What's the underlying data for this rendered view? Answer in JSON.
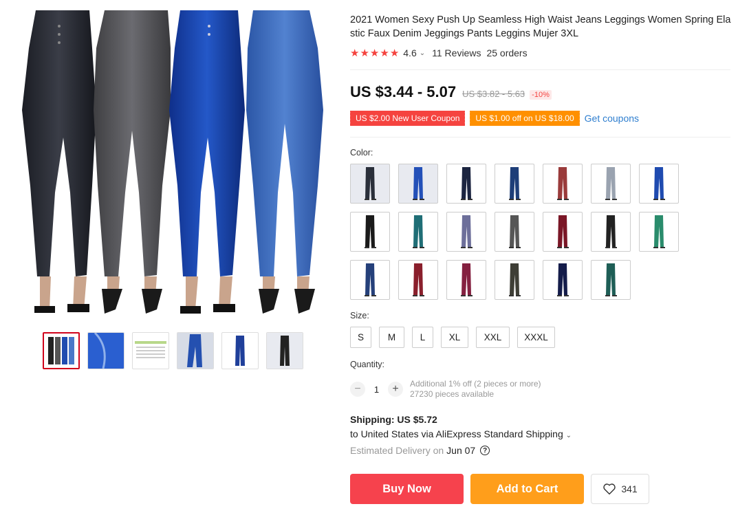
{
  "product": {
    "title": "2021 Women Sexy Push Up Seamless High Waist Jeans Leggings Women Spring Elastic Faux Denim Jeggings Pants Leggins Mujer 3XL",
    "rating": "4.6",
    "reviews": "11 Reviews",
    "orders": "25 orders"
  },
  "price": {
    "current": "US $3.44 - 5.07",
    "original": "US $3.82 - 5.63",
    "discount": "-10%"
  },
  "coupons": {
    "new_user": "US $2.00 New User Coupon",
    "store": "US $1.00 off on US $18.00",
    "get": "Get coupons"
  },
  "color": {
    "label": "Color:",
    "swatches": [
      {
        "name": "gray-stripe",
        "color": "#2a2f3a"
      },
      {
        "name": "blue",
        "color": "#2350b8"
      },
      {
        "name": "dark-navy",
        "color": "#1c2540"
      },
      {
        "name": "navy-denim",
        "color": "#1e3e78"
      },
      {
        "name": "red-brown",
        "color": "#9a3b3b"
      },
      {
        "name": "light-gray",
        "color": "#9aa3b0"
      },
      {
        "name": "royal-blue",
        "color": "#1f4bb0"
      },
      {
        "name": "black",
        "color": "#1a1a1a"
      },
      {
        "name": "teal-pattern",
        "color": "#1f6e76"
      },
      {
        "name": "purple-camo",
        "color": "#6d6f9a"
      },
      {
        "name": "gray-camo",
        "color": "#565656"
      },
      {
        "name": "burgundy",
        "color": "#7a1626"
      },
      {
        "name": "black-leather",
        "color": "#222222"
      },
      {
        "name": "green-pattern",
        "color": "#2a8c6c"
      },
      {
        "name": "denim-blue",
        "color": "#25407a"
      },
      {
        "name": "wine-red",
        "color": "#8a1f2c"
      },
      {
        "name": "red-camo",
        "color": "#842040"
      },
      {
        "name": "black-camo",
        "color": "#3e3e36"
      },
      {
        "name": "navy",
        "color": "#141c4a"
      },
      {
        "name": "teal-camo",
        "color": "#1e5e56"
      }
    ]
  },
  "size": {
    "label": "Size:",
    "options": [
      "S",
      "M",
      "L",
      "XL",
      "XXL",
      "XXXL"
    ]
  },
  "quantity": {
    "label": "Quantity:",
    "minus": "−",
    "value": "1",
    "plus": "+",
    "info1": "Additional 1% off (2 pieces or more)",
    "info2": "27230 pieces available"
  },
  "shipping": {
    "label": "Shipping: US $5.72",
    "to": "to United States via AliExpress Standard Shipping",
    "est_label": "Estimated Delivery on",
    "est_date": "Jun 07",
    "help": "?"
  },
  "actions": {
    "buy": "Buy Now",
    "cart": "Add to Cart",
    "wish_count": "341"
  },
  "icons": {
    "star": "star-icon",
    "heart": "heart-icon",
    "help": "question-icon"
  }
}
